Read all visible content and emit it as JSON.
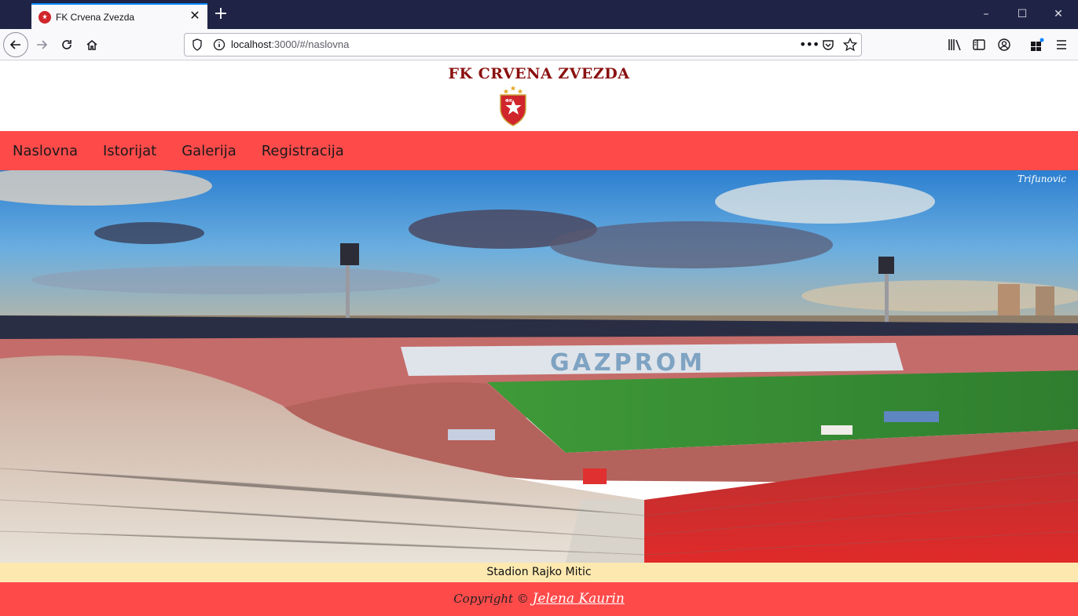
{
  "browser": {
    "tab_title": "FK Crvena Zvezda",
    "url_host": "localhost",
    "url_rest": ":3000/#/naslovna"
  },
  "site": {
    "title": "FK CRVENA ZVEZDA",
    "menu": [
      {
        "label": "Naslovna"
      },
      {
        "label": "Istorijat"
      },
      {
        "label": "Galerija"
      },
      {
        "label": "Registracija"
      }
    ],
    "hero_watermark": "Trifunovic",
    "caption": "Stadion Rajko Mitic",
    "footer_prefix": "Copyright ©",
    "footer_author": "Jelena Kaurin"
  },
  "colors": {
    "menu_bg": "#ff4a4a",
    "caption_bg": "#fde9b0",
    "title_color": "#8a1010",
    "tabbar_bg": "#1f2447"
  },
  "icons": [
    "back-icon",
    "forward-icon",
    "reload-icon",
    "home-icon",
    "shield-icon",
    "info-icon",
    "more-icon",
    "pocket-icon",
    "star-icon",
    "library-icon",
    "sidebar-icon",
    "account-icon",
    "extensions-icon",
    "menu-icon"
  ]
}
